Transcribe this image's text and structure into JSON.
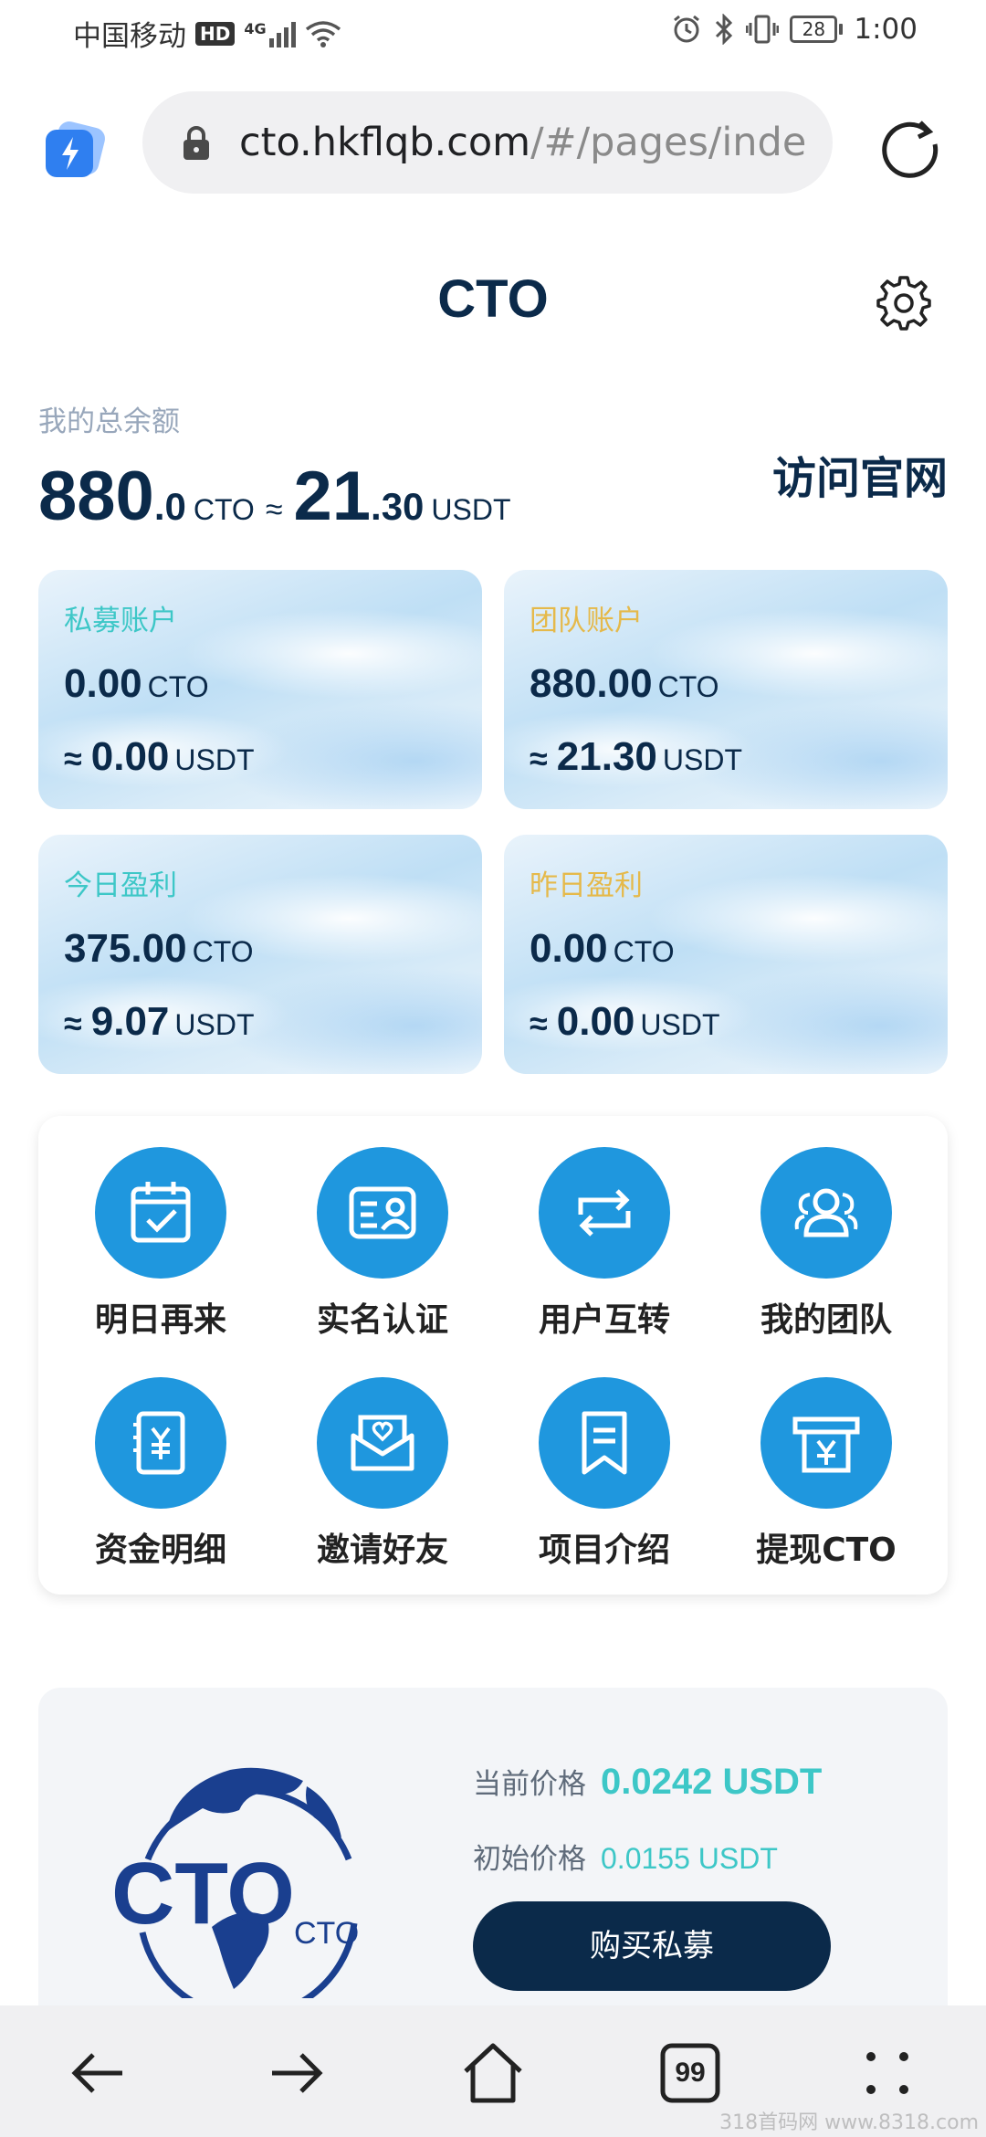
{
  "status_bar": {
    "carrier": "中国移动",
    "hd": "HD",
    "network": "4G",
    "battery": "28",
    "time": "1:00"
  },
  "browser": {
    "url_host": "cto.hkflqb.com",
    "url_path": "/#/pages/inde",
    "icons": [
      "app-logo-icon",
      "lock-icon",
      "reload-icon"
    ]
  },
  "header": {
    "title": "CTO",
    "settings_icon": "gear-icon"
  },
  "balance": {
    "label": "我的总余额",
    "cto_int": "880",
    "cto_dec": ".0",
    "cto_unit": "CTO",
    "approx": "≈",
    "usdt_int": "21",
    "usdt_dec": ".30",
    "usdt_unit": "USDT",
    "visit_site": "访问官网"
  },
  "cards": [
    {
      "title": "私募账户",
      "cto": "0.00",
      "cto_unit": "CTO",
      "approx": "≈",
      "usdt": "0.00",
      "usdt_unit": "USDT",
      "title_color": "#3dc7c7"
    },
    {
      "title": "团队账户",
      "cto": "880.00",
      "cto_unit": "CTO",
      "approx": "≈",
      "usdt": "21.30",
      "usdt_unit": "USDT",
      "title_color": "#e5b94a"
    },
    {
      "title": "今日盈利",
      "cto": "375.00",
      "cto_unit": "CTO",
      "approx": "≈",
      "usdt": "9.07",
      "usdt_unit": "USDT",
      "title_color": "#3dc7c7"
    },
    {
      "title": "昨日盈利",
      "cto": "0.00",
      "cto_unit": "CTO",
      "approx": "≈",
      "usdt": "0.00",
      "usdt_unit": "USDT",
      "title_color": "#e5b94a"
    }
  ],
  "menu": [
    {
      "label": "明日再来",
      "icon": "calendar-check-icon"
    },
    {
      "label": "实名认证",
      "icon": "id-card-icon"
    },
    {
      "label": "用户互转",
      "icon": "transfer-icon"
    },
    {
      "label": "我的团队",
      "icon": "team-icon"
    },
    {
      "label": "资金明细",
      "icon": "fund-detail-icon"
    },
    {
      "label": "邀请好友",
      "icon": "invite-envelope-icon"
    },
    {
      "label": "项目介绍",
      "icon": "bookmark-icon"
    },
    {
      "label": "提现CTO",
      "icon": "withdraw-icon"
    }
  ],
  "menu_color": "#1f97de",
  "price": {
    "logo_text": "CTO",
    "logo_sub": "CTO",
    "current_label": "当前价格",
    "current_value": "0.0242 USDT",
    "initial_label": "初始价格",
    "initial_value": "0.0155 USDT",
    "buy_label": "购买私募"
  },
  "bottom_nav": {
    "tabs_count": "99",
    "icons": [
      "back-arrow-icon",
      "forward-arrow-icon",
      "home-icon",
      "tabs-icon",
      "more-icon"
    ]
  },
  "watermark": "318首码网 www.8318.com"
}
